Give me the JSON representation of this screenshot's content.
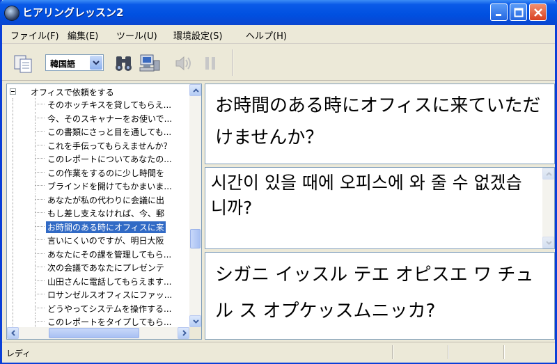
{
  "window": {
    "title": "ヒアリングレッスン2",
    "accent": "#0a5ae8",
    "close_color": "#d84020"
  },
  "icons": {
    "app": "app-globe-icon",
    "minimize": "minimize-icon",
    "maximize": "maximize-icon",
    "close": "close-icon",
    "copy": "copy-icon",
    "find": "binoculars-icon",
    "pc": "computer-speaker-icon",
    "speaker": "speaker-icon",
    "pause": "pause-icon"
  },
  "menu": [
    {
      "label": "ファイル(F)"
    },
    {
      "label": "編集(E)"
    },
    {
      "label": "ツール(U)"
    },
    {
      "label": "環境設定(S)"
    },
    {
      "label": "ヘルプ(H)"
    }
  ],
  "toolbar": {
    "language": "韓国語"
  },
  "tree": {
    "root_label": "オフィスで依頼をする",
    "items": [
      {
        "label": "そのホッチキスを貸してもらえ..."
      },
      {
        "label": "今、そのスキャナーをお使いで..."
      },
      {
        "label": "この書類にさっと目を通しても..."
      },
      {
        "label": "これを手伝ってもらえませんか？"
      },
      {
        "label": "このレポートについてあなたの..."
      },
      {
        "label": "この作業をするのに少し時間を"
      },
      {
        "label": "ブラインドを開けてもかまいま..."
      },
      {
        "label": "あなたが私の代わりに会議に出"
      },
      {
        "label": "もし差し支えなければ、今、郵"
      },
      {
        "label": "お時間のある時にオフィスに来"
      },
      {
        "label": "言いにくいのですが、明日大阪"
      },
      {
        "label": "あなたにその課を管理してもら..."
      },
      {
        "label": "次の会議であなたにプレゼンテ"
      },
      {
        "label": "山田さんに電話してもらえます..."
      },
      {
        "label": "ロサンゼルスオフィスにファッ..."
      },
      {
        "label": "どうやってシステムを操作する..."
      },
      {
        "label": "このレポートをタイプしてもら..."
      }
    ],
    "selected_index": 9
  },
  "panels": {
    "japanese": "お時間のある時にオフィスに来ていただけませんか？",
    "korean": "시간이 있을 때에 오피스에 와 줄 수 없겠습니까?",
    "katakana": "シガニ イッスル テエ オピスエ ワ チュル ス オプケッスムニッカ?"
  },
  "status": {
    "text": "レディ"
  }
}
